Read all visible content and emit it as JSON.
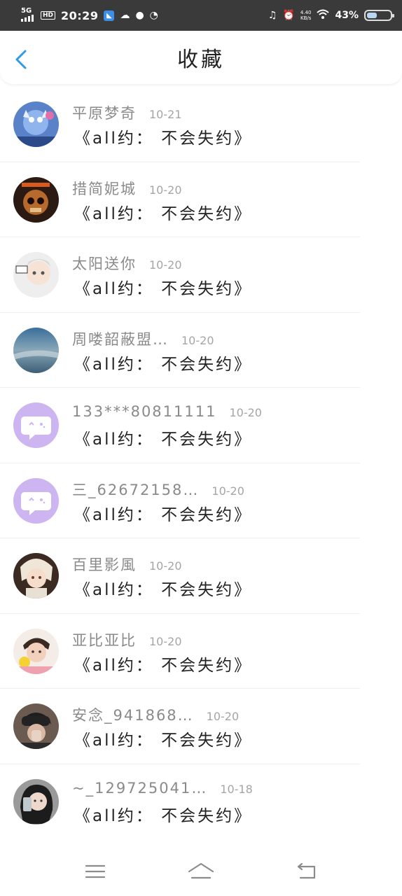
{
  "status_bar": {
    "network": "5G",
    "hd": "HD",
    "time": "20:29",
    "net_speed": "4.40",
    "net_speed_unit": "KB/s",
    "battery_text": "43%",
    "battery_level": 0.43,
    "icons": [
      "signal-icon",
      "hd-icon",
      "app-notification-icon",
      "cloud-icon",
      "chat-bubble-icon",
      "speed-icon",
      "headphones-icon",
      "alarm-icon",
      "wifi-icon",
      "battery-icon"
    ]
  },
  "header": {
    "title": "收藏",
    "back_icon": "chevron-left-icon",
    "accent": "#2d9be8"
  },
  "items": [
    {
      "name": "平原梦奇",
      "date": "10-21",
      "title": "《all约： 不会失约》"
    },
    {
      "name": "措简妮城",
      "date": "10-20",
      "title": "《all约： 不会失约》"
    },
    {
      "name": "太阳送你",
      "date": "10-20",
      "title": "《all约： 不会失约》"
    },
    {
      "name": "周喽韶蔽盟…",
      "date": "10-20",
      "title": "《all约： 不会失约》"
    },
    {
      "name": "133***80811111",
      "date": "10-20",
      "title": "《all约： 不会失约》"
    },
    {
      "name": "三_62672158…",
      "date": "10-20",
      "title": "《all约： 不会失约》"
    },
    {
      "name": "百里影風",
      "date": "10-20",
      "title": "《all约： 不会失约》"
    },
    {
      "name": "亚比亚比",
      "date": "10-20",
      "title": "《all约： 不会失约》"
    },
    {
      "name": "安念_941868…",
      "date": "10-20",
      "title": "《all约： 不会失约》"
    },
    {
      "name": "~_129725041…",
      "date": "10-18",
      "title": "《all约： 不会失约》"
    }
  ],
  "nav_bar": {
    "icons": [
      "menu-icon",
      "home-icon",
      "back-icon"
    ]
  },
  "colors": {
    "status_bar_bg": "#3a3a3a",
    "default_avatar": "#cdb5f2",
    "name_text": "#8a8a8a",
    "date_text": "#a5a5a5"
  }
}
